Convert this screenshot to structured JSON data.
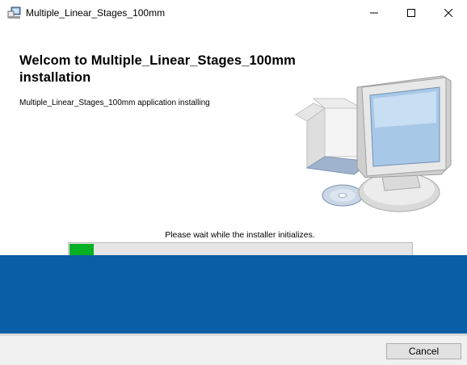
{
  "window": {
    "title": "Multiple_Linear_Stages_100mm",
    "app_icon": "installer-icon",
    "controls": {
      "minimize": "minimize-icon",
      "maximize": "maximize-icon",
      "close": "close-icon"
    }
  },
  "content": {
    "heading": "Welcom to Multiple_Linear_Stages_100mm installation",
    "subtext": "Multiple_Linear_Stages_100mm application installing",
    "illustration": "computer-with-box-and-disc-icon"
  },
  "progress": {
    "status": "Please wait while the installer initializes.",
    "fraction": 0.07,
    "color": "#06b025"
  },
  "footer": {
    "cancel_label": "Cancel"
  },
  "colors": {
    "band": "#0a5ea5",
    "footer": "#f0f0f0"
  }
}
